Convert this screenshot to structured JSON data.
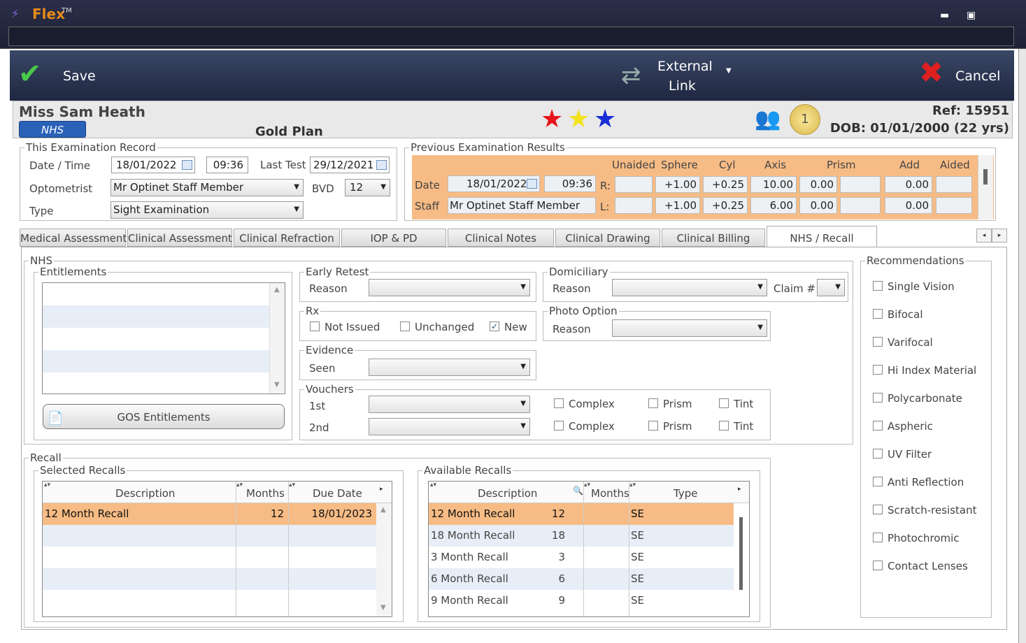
{
  "app": {
    "title": "Flex",
    "tm": "TM"
  },
  "toolbar": {
    "save": "Save",
    "external_link_1": "External",
    "external_link_2": "Link",
    "cancel": "Cancel"
  },
  "patient": {
    "name": "Miss Sam Heath",
    "badge": "NHS",
    "plan": "Gold Plan",
    "ref": "Ref: 15951",
    "dob": "DOB: 01/01/2000 (22 yrs)",
    "loyalty_count": "1"
  },
  "exam": {
    "legend": "This Examination Record",
    "date_time_label": "Date / Time",
    "date": "18/01/2022",
    "time": "09:36",
    "last_test_label": "Last Test",
    "last_test": "29/12/2021",
    "optometrist_label": "Optometrist",
    "optometrist": "Mr Optinet Staff Member",
    "bvd_label": "BVD",
    "bvd": "12",
    "type_label": "Type",
    "type": "Sight Examination"
  },
  "previous": {
    "legend": "Previous Examination Results",
    "headers": [
      "Unaided",
      "Sphere",
      "Cyl",
      "Axis",
      "Prism",
      "Add",
      "Aided"
    ],
    "date_label": "Date",
    "date": "18/01/2022",
    "time": "09:36",
    "staff_label": "Staff",
    "staff": "Mr Optinet Staff Member",
    "r_label": "R:",
    "l_label": "L:",
    "r": {
      "sphere": "+1.00",
      "cyl": "+0.25",
      "axis": "10.00",
      "prism": "0.00",
      "add": "0.00"
    },
    "l": {
      "sphere": "+1.00",
      "cyl": "+0.25",
      "axis": "6.00",
      "prism": "0.00",
      "add": "0.00"
    }
  },
  "tabs": [
    "Medical Assessment",
    "Clinical Assessment",
    "Clinical Refraction",
    "IOP & PD",
    "Clinical Notes",
    "Clinical Drawing",
    "Clinical Billing",
    "NHS / Recall"
  ],
  "nhs": {
    "legend": "NHS",
    "entitlements": "Entitlements",
    "gos_button": "GOS Entitlements",
    "early_retest": "Early Retest",
    "reason": "Reason",
    "domiciliary": "Domiciliary",
    "claim": "Claim #",
    "rx": "Rx",
    "not_issued": "Not Issued",
    "unchanged": "Unchanged",
    "new": "New",
    "photo_option": "Photo Option",
    "evidence": "Evidence",
    "seen": "Seen",
    "vouchers": "Vouchers",
    "first": "1st",
    "second": "2nd",
    "complex": "Complex",
    "prism": "Prism",
    "tint": "Tint"
  },
  "recommendations": {
    "legend": "Recommendations",
    "items": [
      "Single Vision",
      "Bifocal",
      "Varifocal",
      "Hi Index Material",
      "Polycarbonate",
      "Aspheric",
      "UV Filter",
      "Anti Reflection",
      "Scratch-resistant",
      "Photochromic",
      "Contact Lenses"
    ]
  },
  "recall": {
    "legend": "Recall",
    "selected_legend": "Selected Recalls",
    "available_legend": "Available Recalls",
    "selected_headers": [
      "Description",
      "Months",
      "Due Date"
    ],
    "selected": [
      {
        "description": "12 Month Recall",
        "months": "12",
        "due": "18/01/2023"
      }
    ],
    "available_headers": [
      "Description",
      "Months",
      "Type"
    ],
    "available": [
      {
        "description": "12 Month Recall",
        "months": "12",
        "type": "SE"
      },
      {
        "description": "18 Month Recall",
        "months": "18",
        "type": "SE"
      },
      {
        "description": "3 Month Recall",
        "months": "3",
        "type": "SE"
      },
      {
        "description": "6 Month Recall",
        "months": "6",
        "type": "SE"
      },
      {
        "description": "9 Month Recall",
        "months": "9",
        "type": "SE"
      }
    ]
  },
  "colors": {
    "accent_orange": "#f7bc85",
    "nhs_blue": "#2a62b8",
    "toolbar": "#2c3858"
  }
}
